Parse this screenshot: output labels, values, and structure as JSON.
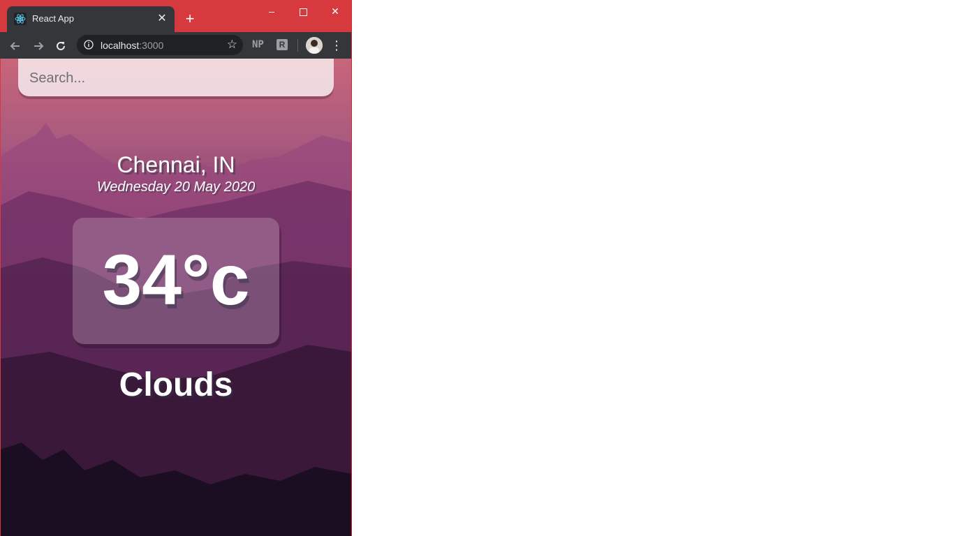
{
  "browser": {
    "tab_title": "React App",
    "url_host": "localhost",
    "url_port": ":3000",
    "extension_np": "NP",
    "extension_r": "R"
  },
  "search": {
    "placeholder": "Search..."
  },
  "weather": {
    "location": "Chennai, IN",
    "date": "Wednesday 20 May 2020",
    "temperature": "34°c",
    "condition": "Clouds"
  },
  "colors": {
    "titlebar": "#d63a3f",
    "toolbar": "#35363a"
  }
}
